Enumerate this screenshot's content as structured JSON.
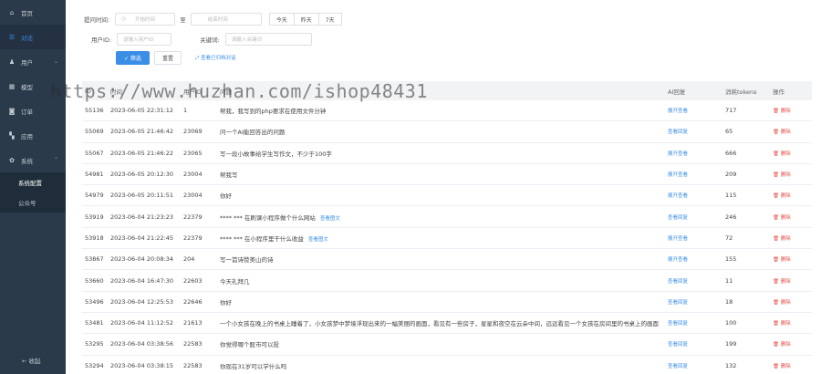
{
  "sidebar": {
    "items": [
      {
        "label": "首页",
        "icon": "home-icon",
        "glyph": "⌂"
      },
      {
        "label": "对话",
        "icon": "list-icon",
        "glyph": "☰",
        "active": true
      },
      {
        "label": "用户",
        "icon": "user-icon",
        "glyph": "♟",
        "chev": "⌄"
      },
      {
        "label": "模型",
        "icon": "grid-icon",
        "glyph": "▦"
      },
      {
        "label": "订单",
        "icon": "bag-icon",
        "glyph": "◙"
      },
      {
        "label": "应用",
        "icon": "apps-icon",
        "glyph": "▚"
      },
      {
        "label": "系统",
        "icon": "gear-icon",
        "glyph": "✿",
        "chev": "⌃"
      }
    ],
    "sub_items": [
      {
        "label": "系统配置",
        "active": true
      },
      {
        "label": "公众号"
      }
    ],
    "collapse_label": "← 收起"
  },
  "filter": {
    "time_label": "提问时间:",
    "start_placeholder": "开始时间",
    "range_sep": "至",
    "end_placeholder": "结束时间",
    "quick": [
      "今天",
      "昨天",
      "7天"
    ],
    "uid_label": "用户ID:",
    "uid_placeholder": "请输入用户ID",
    "keyword_label": "关键词:",
    "keyword_placeholder": "请输入关键词",
    "search_label": "✓ 筛选",
    "reset_label": "重置",
    "link_label": "⤢ 查看已归档对话"
  },
  "table": {
    "headers": {
      "id": "ID",
      "time": "时间",
      "uid": "用户ID",
      "q": "问题",
      "ai": "AI回复",
      "tok": "消耗tokens",
      "op": "操作"
    },
    "rows": [
      {
        "id": "55136",
        "time": "2023-06-05 22:31:12",
        "uid": "1",
        "q": "帮我，我写到的php要求在使用文件分钟",
        "ai": "展开查看",
        "tok": "717",
        "op": "🗑 删除"
      },
      {
        "id": "55069",
        "time": "2023-06-05 21:46:42",
        "uid": "23069",
        "q": "问一个AI能回答出的问题",
        "ai": "查看回复",
        "tok": "65",
        "op": "🗑 删除"
      },
      {
        "id": "55067",
        "time": "2023-06-05 21:46:22",
        "uid": "23065",
        "q": "写一段小故事给学生写作文，不少于100字",
        "ai": "展开查看",
        "tok": "666",
        "op": "🗑 删除"
      },
      {
        "id": "54981",
        "time": "2023-06-05 20:12:30",
        "uid": "23004",
        "q": "帮我写",
        "ai": "展开查看",
        "tok": "209",
        "op": "🗑 删除"
      },
      {
        "id": "54979",
        "time": "2023-06-05 20:11:51",
        "uid": "23004",
        "q": "你好",
        "ai": "展开查看",
        "tok": "115",
        "op": "🗑 删除"
      },
      {
        "id": "53919",
        "time": "2023-06-04 21:23:23",
        "uid": "22379",
        "q": "**** ***  在刷课小程序做个什么网站",
        "q_link": "查看图文",
        "ai": "查看回复",
        "tok": "246",
        "op": "🗑 删除"
      },
      {
        "id": "53918",
        "time": "2023-06-04 21:22:45",
        "uid": "22379",
        "q": "**** ***  在小程序里干什么收益",
        "q_link": "查看图文",
        "ai": "展开查看",
        "tok": "72",
        "op": "🗑 删除"
      },
      {
        "id": "53867",
        "time": "2023-06-04 20:08:34",
        "uid": "204",
        "q": "写一首诗赞美山的诗",
        "ai": "展开查看",
        "tok": "155",
        "op": "🗑 删除"
      },
      {
        "id": "53660",
        "time": "2023-06-04 16:47:30",
        "uid": "22603",
        "q": "今天礼拜几",
        "ai": "查看回复",
        "tok": "11",
        "op": "🗑 删除"
      },
      {
        "id": "53496",
        "time": "2023-06-04 12:25:53",
        "uid": "22646",
        "q": "你好",
        "ai": "查看回复",
        "tok": "18",
        "op": "🗑 删除"
      },
      {
        "id": "53481",
        "time": "2023-06-04 11:12:52",
        "uid": "21613",
        "q": "一个小女孩在晚上的书桌上睡着了，小女孩梦中梦境浮现出来的一幅美丽的画面，看见有一些房子，星星和夜空在云朵中间，远远看见一个女孩在房间里的书桌上的画面",
        "ai": "查看回复",
        "tok": "100",
        "op": "🗑 删除"
      },
      {
        "id": "53295",
        "time": "2023-06-04 03:38:56",
        "uid": "22583",
        "q": "你觉得哪个股市可以投",
        "ai": "查看回复",
        "tok": "199",
        "op": "🗑 删除"
      },
      {
        "id": "53294",
        "time": "2023-06-04 03:38:15",
        "uid": "22583",
        "q": "你现在31岁可以学什么吗",
        "ai": "查看回复",
        "tok": "132",
        "op": "🗑 删除"
      }
    ]
  },
  "watermark": "https://www.huzhan.com/ishop48431",
  "colors": {
    "sidebar": "#2b3a4a",
    "accent": "#3a8ee6",
    "danger": "#e54d42"
  }
}
